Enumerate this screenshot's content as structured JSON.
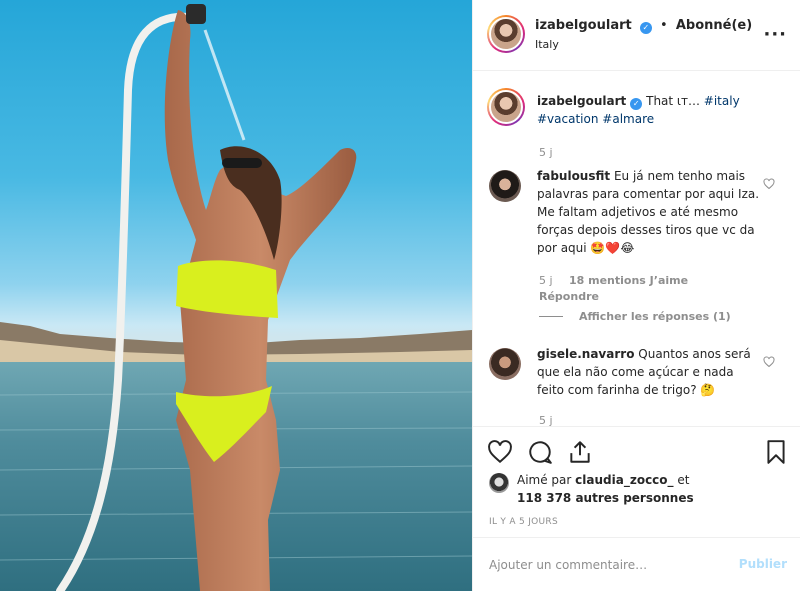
{
  "post": {
    "author": "izabelgoulart",
    "following_label": "Abonné(e)",
    "location": "Italy",
    "more_icon": "more-horizontal-icon"
  },
  "caption": {
    "username": "izabelgoulart",
    "text": "That ιт…",
    "tags": [
      "#italy",
      "#vacation",
      "#almare"
    ],
    "time": "5 j"
  },
  "comments": [
    {
      "username": "fabulousfit",
      "text": "Eu já nem tenho mais palavras para comentar por aqui Iza. Me faltam adjetivos e até mesmo forças depois desses tiros que vc da por aqui 🤩❤️😂",
      "time": "5 j",
      "likes": "18 mentions J’aime",
      "reply_label": "Répondre",
      "replies_label": "Afficher les réponses (1)"
    },
    {
      "username": "gisele.navarro",
      "text": "Quantos anos será que ela não come açúcar e nada feito com farinha de trigo? 🤔",
      "time": "5 j"
    }
  ],
  "likes": {
    "prefix": "Aimé par",
    "user": "claudia_zocco_",
    "connector": "et",
    "others": "118 378 autres personnes"
  },
  "posted_ago": "IL Y A 5 JOURS",
  "composer": {
    "placeholder": "Ajouter un commentaire…",
    "post_label": "Publier"
  },
  "colors": {
    "verified": "#3897f0",
    "link": "#00376b",
    "muted": "#8e8e8e",
    "post_disabled": "#b2dffc"
  }
}
